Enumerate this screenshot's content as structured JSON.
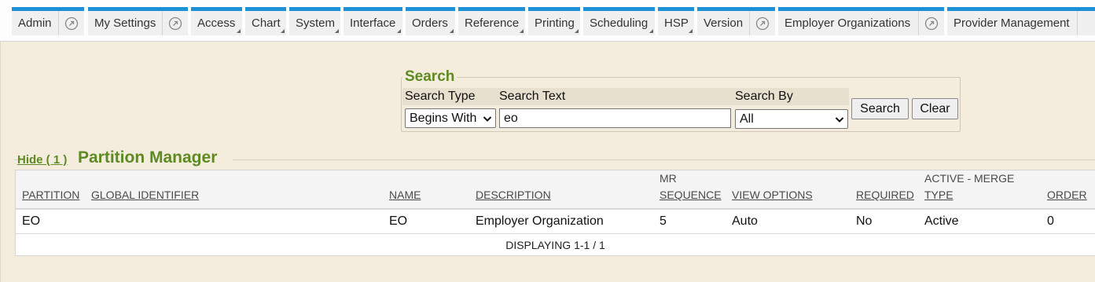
{
  "tabs": [
    {
      "label": "Admin",
      "popout": true
    },
    {
      "label": "My Settings",
      "popout": true
    },
    {
      "label": "Access",
      "popout": false
    },
    {
      "label": "Chart",
      "popout": false
    },
    {
      "label": "System",
      "popout": false
    },
    {
      "label": "Interface",
      "popout": false
    },
    {
      "label": "Orders",
      "popout": false
    },
    {
      "label": "Reference",
      "popout": false
    },
    {
      "label": "Printing",
      "popout": false
    },
    {
      "label": "Scheduling",
      "popout": false
    },
    {
      "label": "HSP",
      "popout": false
    },
    {
      "label": "Version",
      "popout": true
    },
    {
      "label": "Employer Organizations",
      "popout": true
    },
    {
      "label": "Provider Management",
      "popout": false
    }
  ],
  "search": {
    "legend": "Search",
    "type_label": "Search Type",
    "type_value": "Begins With",
    "text_label": "Search Text",
    "text_value": "eo",
    "by_label": "Search By",
    "by_value": "All",
    "search_button": "Search",
    "clear_button": "Clear"
  },
  "partition_manager": {
    "hide_link": "Hide ( 1 )",
    "title": "Partition Manager",
    "columns": {
      "partition": "PARTITION",
      "global_identifier": "GLOBAL IDENTIFIER",
      "name": "NAME",
      "description": "DESCRIPTION",
      "mr_sequence_1": "MR",
      "mr_sequence_2": "SEQUENCE",
      "view_options": "VIEW OPTIONS",
      "required": "REQUIRED",
      "active_merge_1": "ACTIVE - MERGE",
      "active_merge_2": "TYPE",
      "order": "ORDER"
    },
    "rows": [
      {
        "partition": "EO",
        "global_identifier": "",
        "name": "EO",
        "description": "Employer Organization",
        "mr_sequence": "5",
        "view_options": "Auto",
        "required": "No",
        "active_merge_type": "Active",
        "order": "0"
      }
    ],
    "footer": "DISPLAYING 1-1 / 1"
  },
  "colors": {
    "accent": "#1e90d6",
    "heading": "#5d8a21",
    "background": "#f4ecdc"
  }
}
